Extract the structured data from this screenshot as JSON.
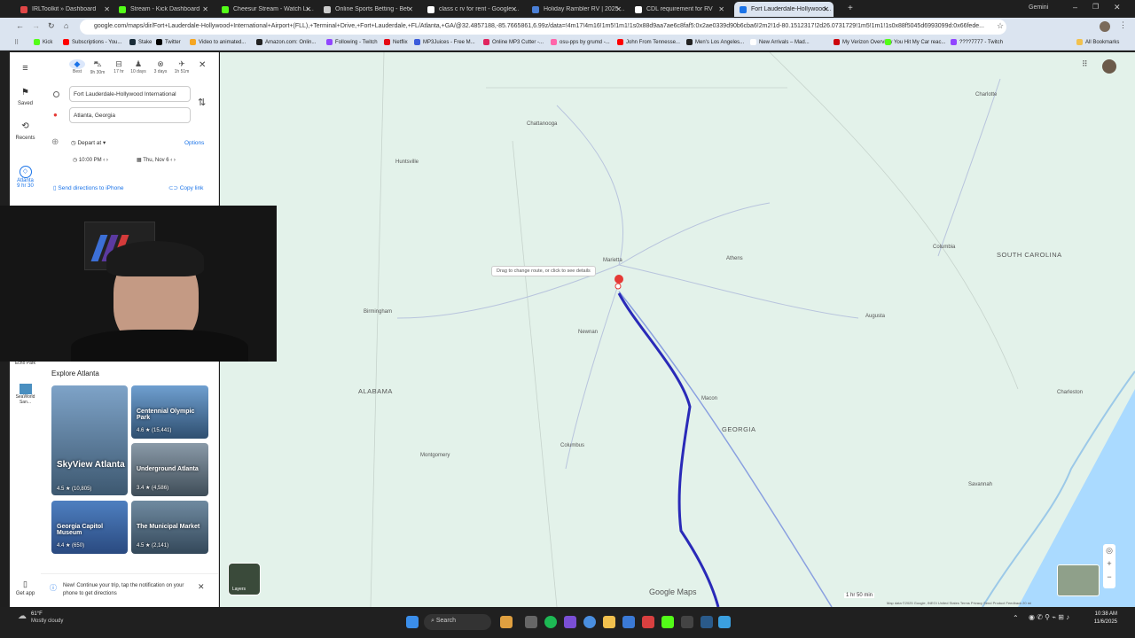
{
  "browser": {
    "tabs": [
      {
        "label": "IRLToolkit » Dashboard",
        "color": "#e04646"
      },
      {
        "label": "Stream - Kick Dashboard",
        "color": "#53fc18"
      },
      {
        "label": "Cheesur Stream - Watch Live o",
        "color": "#53fc18"
      },
      {
        "label": "Online Sports Betting - Bet",
        "color": "#cccccc"
      },
      {
        "label": "class c rv for rent - Google Sea",
        "color": "#ffffff"
      },
      {
        "label": "Holiday Rambler RV | 2025 Cl",
        "color": "#4a7fd6"
      },
      {
        "label": "CDL requirement for RV",
        "color": "#ffffff"
      },
      {
        "label": "Fort Lauderdale-Hollywood Inte",
        "color": "#1a73e8"
      }
    ],
    "gemini_label": "Gemini",
    "url": "google.com/maps/dir/Fort+Lauderdale-Hollywood+International+Airport+(FLL),+Terminal+Drive,+Fort+Lauderdale,+FL/Atlanta,+GA/@32.4857188,-85.7665861,6.99z/data=!4m17!4m16!1m5!1m1!1s0x88d9aa7ae6c8faf5:0x2ae0339d90b6cba6!2m2!1d-80.1512317!2d26.0731729!1m5!1m1!1s0x88f5045d6993099d:0x66fede...",
    "bookmarks": [
      {
        "label": "Kick",
        "color": "#53fc18"
      },
      {
        "label": "Subscriptions - You...",
        "color": "#ff0000"
      },
      {
        "label": "Stake",
        "color": "#1a2c38"
      },
      {
        "label": "Twitter",
        "color": "#000000"
      },
      {
        "label": "Video to animated...",
        "color": "#f5a623"
      },
      {
        "label": "Amazon.com: Onlin...",
        "color": "#222222"
      },
      {
        "label": "Following - Twitch",
        "color": "#9146ff"
      },
      {
        "label": "Netflix",
        "color": "#e50914"
      },
      {
        "label": "MP3Juices - Free M...",
        "color": "#3b5bdb"
      },
      {
        "label": "Online MP3 Cutter -...",
        "color": "#e0245e"
      },
      {
        "label": "osu-pps by grumd -...",
        "color": "#ff66aa"
      },
      {
        "label": "John From Tennesse...",
        "color": "#ff0000"
      },
      {
        "label": "Men's Los Angeles...",
        "color": "#222222"
      },
      {
        "label": "New Arrivals – Mad...",
        "color": "#ffffff"
      },
      {
        "label": "My Verizon Overview",
        "color": "#cd040b"
      },
      {
        "label": "You Hit My Car reac...",
        "color": "#53fc18"
      },
      {
        "label": "????7777 - Twitch",
        "color": "#9146ff"
      }
    ],
    "all_bookmarks": "All Bookmarks"
  },
  "rail": {
    "saved": "Saved",
    "recents": "Recents",
    "atlanta": "Atlanta",
    "atlanta_time": "9 hr 30",
    "echo_park": "Echo Park",
    "seaworld": "SeaWorld San...",
    "get_app": "Get app"
  },
  "directions": {
    "modes": [
      {
        "icon": "directions-icon",
        "time": "Best"
      },
      {
        "icon": "car-icon",
        "time": "9h 30m"
      },
      {
        "icon": "transit-icon",
        "time": "17 hr"
      },
      {
        "icon": "walk-icon",
        "time": "10 days"
      },
      {
        "icon": "bike-icon",
        "time": "3 days"
      },
      {
        "icon": "flight-icon",
        "time": "1h 51m"
      }
    ],
    "origin": "Fort Lauderdale-Hollywood International",
    "destination": "Atlanta, Georgia",
    "depart_label": "Depart at",
    "options_label": "Options",
    "time": "10:00 PM",
    "date": "Thu, Nov 6",
    "send_label": "Send directions to iPhone",
    "copy_label": "Copy link"
  },
  "explore": {
    "title": "Explore Atlanta",
    "cards": [
      {
        "name": "SkyView Atlanta",
        "rating": "4.5 ★ (10,805)"
      },
      {
        "name": "Centennial Olympic Park",
        "rating": "4.6 ★ (15,441)"
      },
      {
        "name": "Underground Atlanta",
        "rating": "3.4 ★ (4,586)"
      },
      {
        "name": "Georgia Capitol Museum",
        "rating": "4.4 ★ (650)"
      },
      {
        "name": "The Municipal Market",
        "rating": "4.5 ★ (2,141)"
      }
    ]
  },
  "notification": "New! Continue your trip, tap the notification on your phone to get directions",
  "map": {
    "tooltip": "Drag to change route, or click to see details",
    "labels": {
      "charlotte": "Charlotte",
      "chattanooga": "Chattanooga",
      "huntsville": "Huntsville",
      "marietta": "Marietta",
      "athens": "Athens",
      "columbia": "Columbia",
      "south_carolina": "SOUTH CAROLINA",
      "birmingham": "Birmingham",
      "augusta": "Augusta",
      "newnan": "Newnan",
      "alabama": "ALABAMA",
      "macon": "Macon",
      "georgia": "GEORGIA",
      "charleston": "Charleston",
      "columbus": "Columbus",
      "montgomery": "Montgomery",
      "savannah": "Savannah"
    },
    "route_time": "1 hr 50 min",
    "watermark": "Google Maps",
    "layers": "Layers",
    "footer": "Map data ©2025 Google, INEGI   United States   Terms   Privacy   Send Product Feedback   20 mi"
  },
  "taskbar": {
    "weather_temp": "61°F",
    "weather_desc": "Mostly cloudy",
    "search": "Search",
    "time": "10:38 AM",
    "date": "11/6/2025"
  }
}
